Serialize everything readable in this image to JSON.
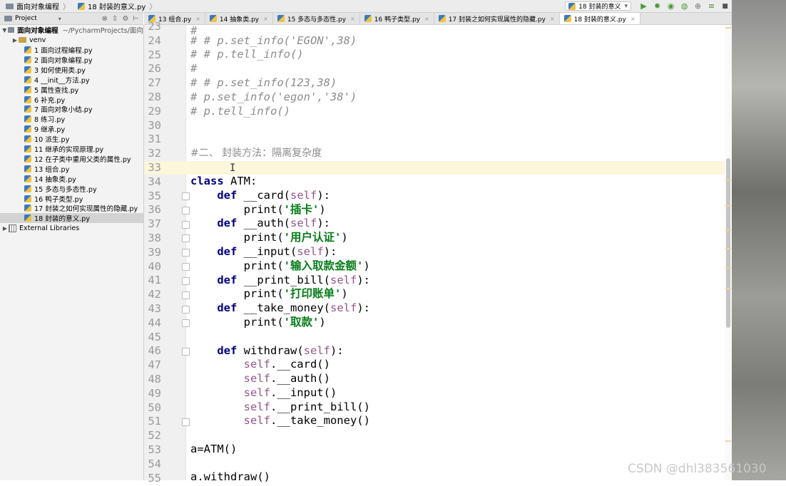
{
  "breadcrumb": {
    "project": "面向对象编程",
    "file": "18 封装的意义.py"
  },
  "run_config": {
    "label": "18 封装的意义"
  },
  "project_pane": {
    "title": "Project"
  },
  "tabs": [
    {
      "label": "13 组合.py"
    },
    {
      "label": "14 抽象类.py"
    },
    {
      "label": "15 多态与多态性.py"
    },
    {
      "label": "16 鸭子类型.py"
    },
    {
      "label": "17 封装之如何实现属性的隐藏.py"
    },
    {
      "label": "18 封装的意义.py"
    }
  ],
  "tree": {
    "root_label": "面向对象编程",
    "root_path": "~/PycharmProjects/面向",
    "venv": "venv",
    "files": [
      "1 面向过程编程.py",
      "2 面向对象编程.py",
      "3 如何使用类.py",
      "4 __init__方法.py",
      "5 属性查找.py",
      "6 补充.py",
      "7 面向对象小结.py",
      "8 练习.py",
      "9 继承.py",
      "10 派生.py",
      "11 继承的实现原理.py",
      "12 在子类中重用父类的属性.py",
      "13 组合.py",
      "14 抽象类.py",
      "15 多态与多态性.py",
      "16 鸭子类型.py",
      "17 封装之如何实现属性的隐藏.py",
      "18 封装的意义.py"
    ],
    "external": "External Libraries"
  },
  "editor": {
    "line_numbers": [
      "23",
      "24",
      "25",
      "26",
      "27",
      "28",
      "29",
      "30",
      "31",
      "32",
      "33",
      "34",
      "35",
      "36",
      "37",
      "38",
      "39",
      "40",
      "41",
      "42",
      "43",
      "44",
      "45",
      "46",
      "47",
      "48",
      "49",
      "50",
      "51",
      "52",
      "53",
      "54",
      "55"
    ],
    "lines": {
      "l23": "#",
      "l24": "# # p.set_info('EGON',38)",
      "l25": "# # p.tell_info()",
      "l26": "#",
      "l27": "# # p.set_info(123,38)",
      "l28": "# p.set_info('egon','38')",
      "l29": "# p.tell_info()",
      "l32": "#二、 封装方法：隔离复杂度",
      "l34_kw": "class",
      "l34_rest": " ATM:",
      "def": "def",
      "self": "self",
      "print": "print(",
      "close": ")",
      "close_colon": "):",
      "m_card": "__card(",
      "m_auth": "__auth(",
      "m_input": "__input(",
      "m_bill": "__print_bill(",
      "m_money": "__take_money(",
      "s_card": "'插卡'",
      "s_auth": "'用户认证'",
      "s_input": "'输入取款金额'",
      "s_bill": "'打印账单'",
      "s_money": "'取款'",
      "m_withdraw": "withdraw(",
      "c_card": ".__card()",
      "c_auth": ".__auth()",
      "c_input": ".__input()",
      "c_bill": ".__print_bill()",
      "c_money": ".__take_money()",
      "l53": "a=ATM()",
      "l55": "a.withdraw()"
    }
  },
  "watermark": "CSDN @dhl383561030"
}
